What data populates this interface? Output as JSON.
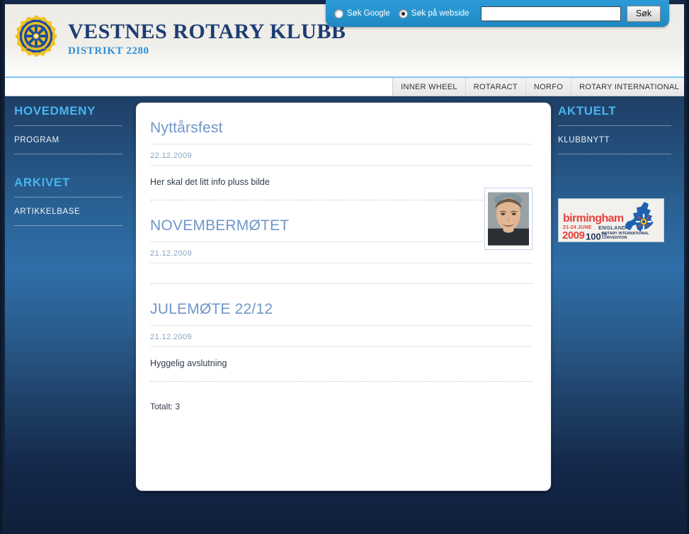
{
  "header": {
    "logo_icon": "rotary-wheel-icon",
    "title": "VESTNES ROTARY KLUBB",
    "subtitle": "DISTRIKT 2280"
  },
  "search": {
    "option_google_label": "Søk Google",
    "option_google_selected": false,
    "option_website_label": "Søk på webside",
    "option_website_selected": true,
    "input_value": "",
    "input_placeholder": "",
    "button_label": "Søk",
    "panel_color": "#2492cd"
  },
  "topnav": {
    "items": [
      {
        "label": "INNER WHEEL"
      },
      {
        "label": "ROTARACT"
      },
      {
        "label": "NORFO"
      },
      {
        "label": "ROTARY INTERNATIONAL"
      }
    ]
  },
  "sidebar_left": {
    "blocks": [
      {
        "heading": "HOVEDMENY",
        "items": [
          {
            "label": "PROGRAM"
          }
        ]
      },
      {
        "heading": "ARKIVET",
        "items": [
          {
            "label": "ARTIKKELBASE"
          }
        ]
      }
    ],
    "heading_color": "#49b4ef"
  },
  "sidebar_right": {
    "heading": "AKTUELT",
    "items": [
      {
        "label": "KLUBBNYTT"
      }
    ],
    "banner": {
      "city": "birmingham",
      "dates": "21-24 JUNE",
      "country": "ENGLAND",
      "year": "2009",
      "ordinal": "100",
      "ordinal_suffix": "TH",
      "convention": "ROTARY INTERNATIONAL CONVENTION",
      "accent_color": "#e8403a",
      "map_icon": "uk-map-icon"
    }
  },
  "content": {
    "articles": [
      {
        "title": "Nyttårsfest",
        "date": "22.12.2009",
        "body": "Her skal det litt info pluss bilde",
        "has_photo": false
      },
      {
        "title": "NOVEMBERMØTET",
        "date": "21.12.2009",
        "body": "",
        "has_photo": true,
        "photo_alt": "portrait-photo"
      },
      {
        "title": "JULEMØTE 22/12",
        "date": "21.12.2009",
        "body": "Hyggelig avslutning",
        "has_photo": false
      }
    ],
    "total_label": "Totalt: 3"
  }
}
